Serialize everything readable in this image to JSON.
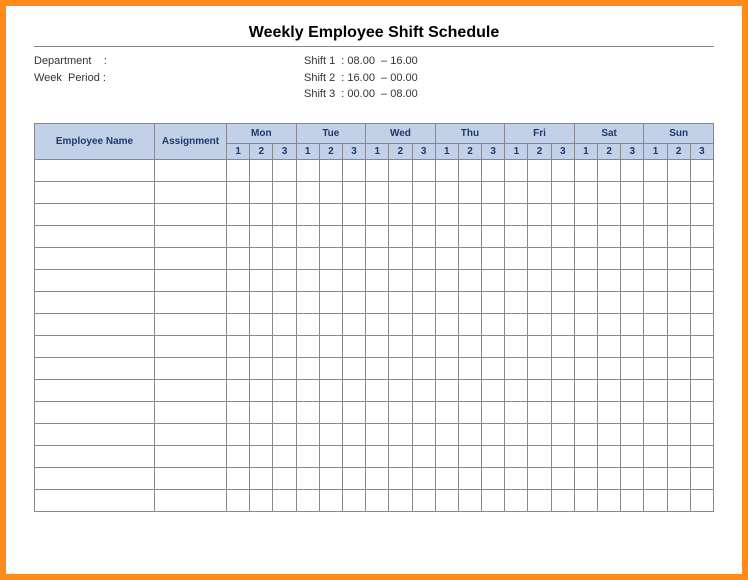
{
  "header": {
    "title": "Weekly Employee Shift Schedule",
    "department_label": "Department    :",
    "week_period_label": "Week  Period :",
    "shift1": "Shift 1  : 08.00  – 16.00",
    "shift2": "Shift 2  : 16.00  – 00.00",
    "shift3": "Shift 3  : 00.00  – 08.00"
  },
  "columns": {
    "employee_name": "Employee Name",
    "assignment": "Assignment",
    "days": [
      "Mon",
      "Tue",
      "Wed",
      "Thu",
      "Fri",
      "Sat",
      "Sun"
    ],
    "shifts": [
      "1",
      "2",
      "3"
    ]
  },
  "rows": 16
}
